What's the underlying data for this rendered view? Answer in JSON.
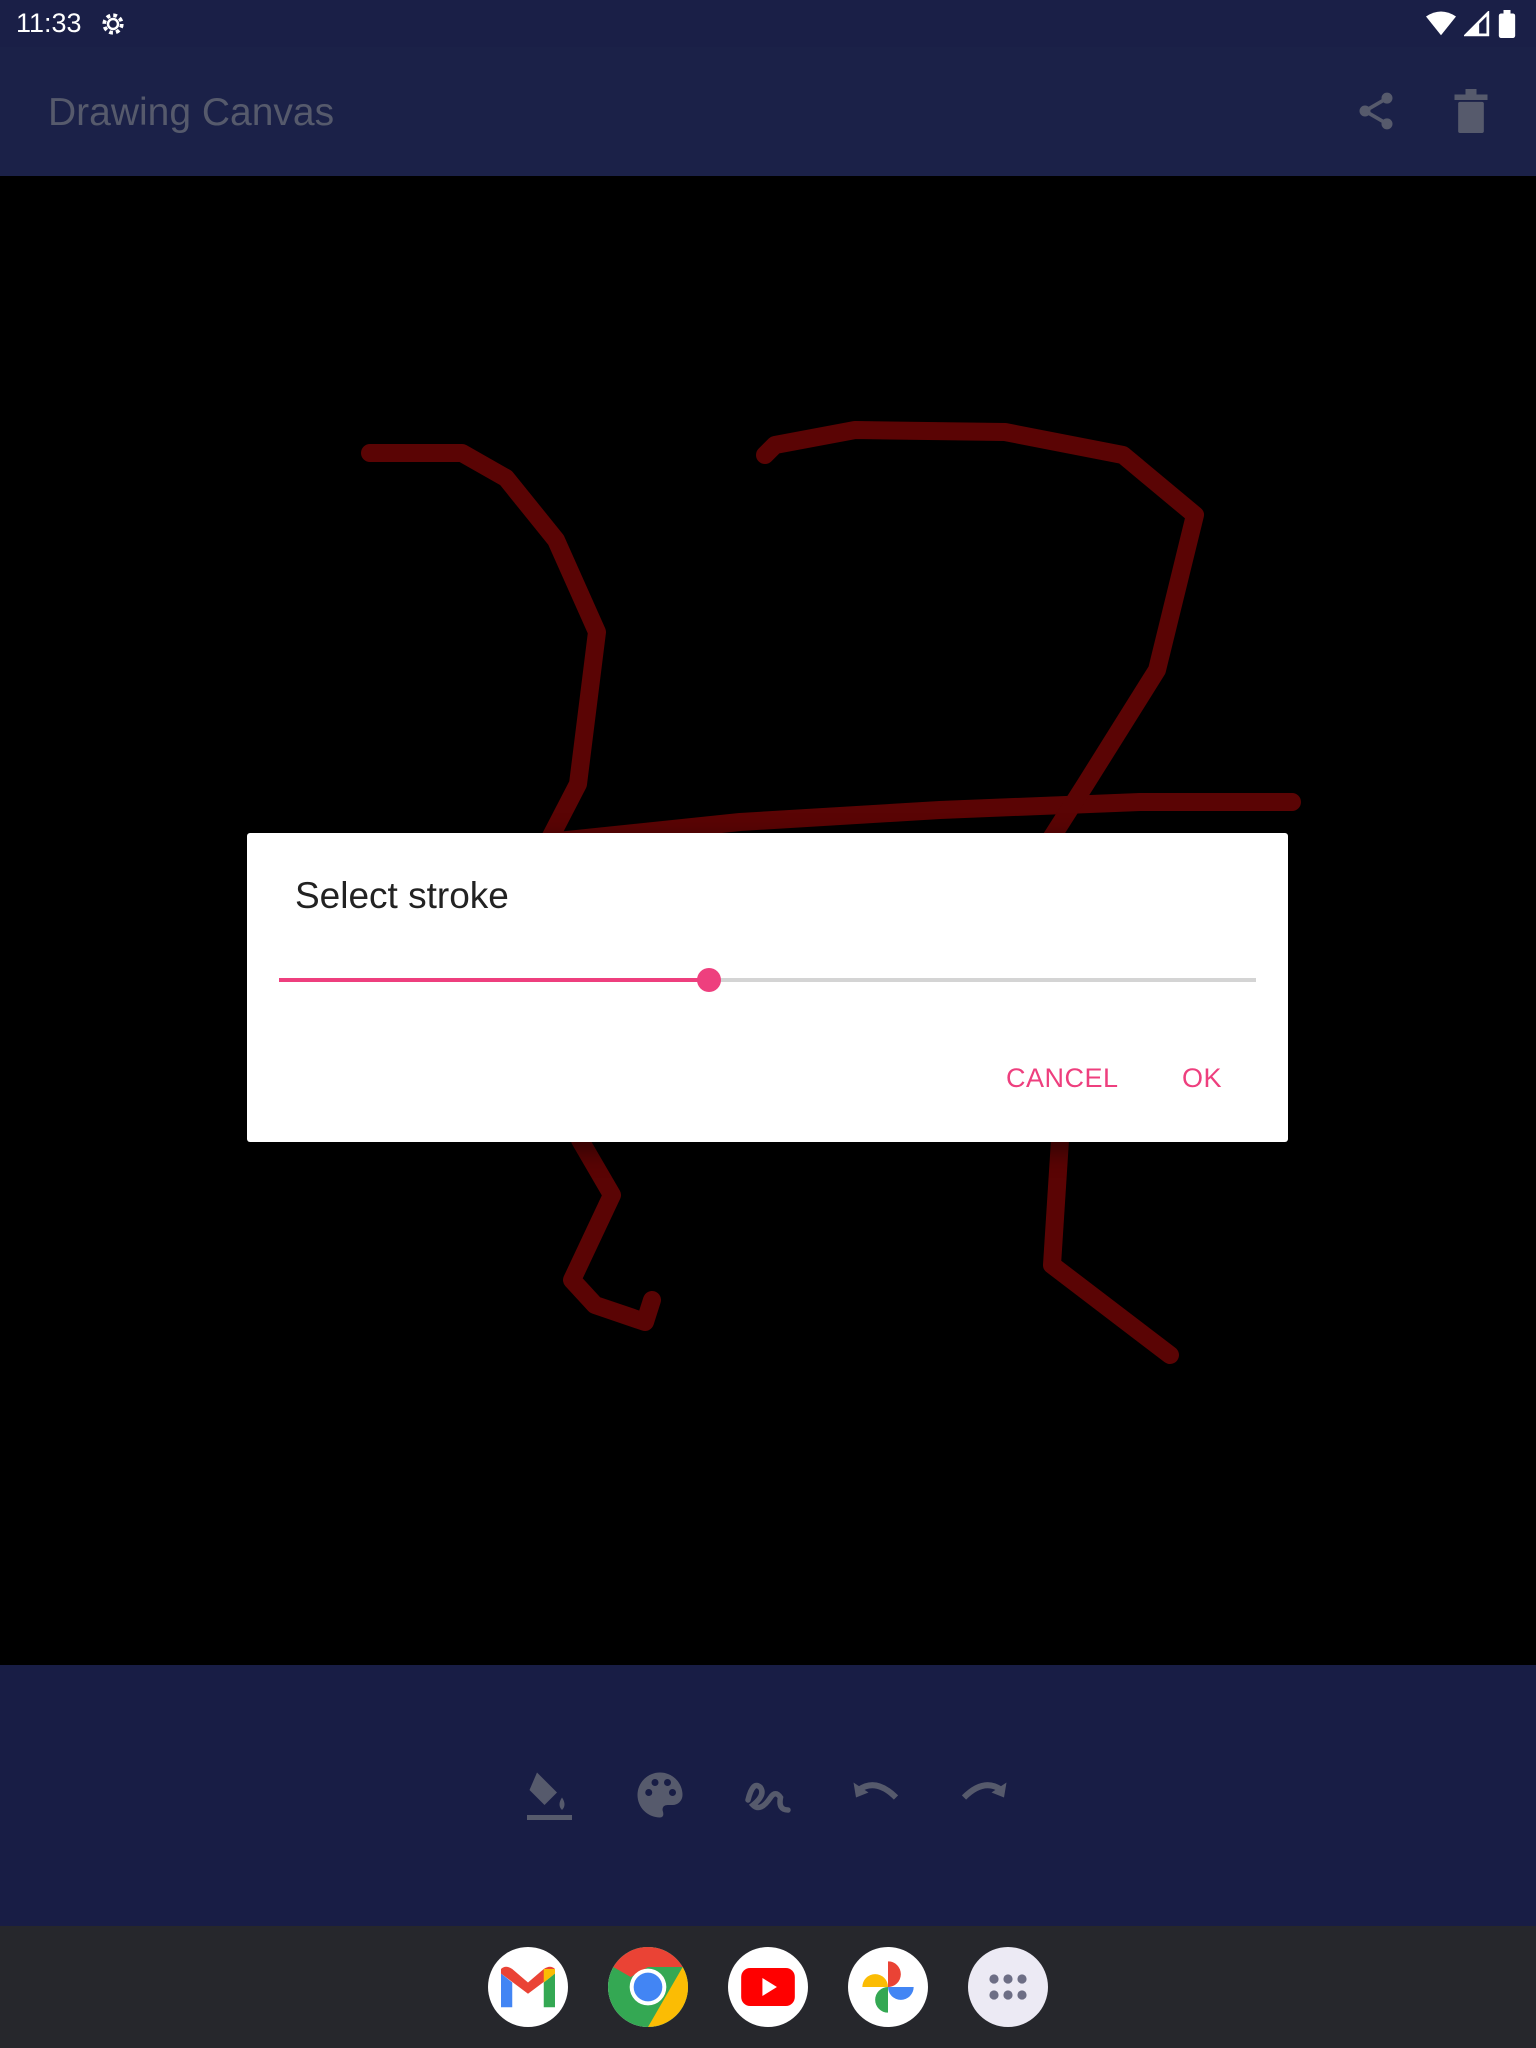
{
  "status_bar": {
    "time": "11:33",
    "icons": [
      "settings-icon",
      "wifi-icon",
      "signal-icon",
      "battery-icon"
    ]
  },
  "app_bar": {
    "title": "Drawing Canvas",
    "actions": [
      "share-icon",
      "delete-icon"
    ]
  },
  "dialog": {
    "title": "Select stroke",
    "stroke_level": 0.44,
    "cancel_label": "CANCEL",
    "ok_label": "OK"
  },
  "toolbar": {
    "tools": [
      "fill-color-icon",
      "palette-icon",
      "stroke-icon",
      "undo-icon",
      "redo-icon"
    ]
  },
  "dock": {
    "apps": [
      "Gmail",
      "Chrome",
      "YouTube",
      "Photos",
      "App drawer"
    ]
  },
  "colors": {
    "accent": "#ee3f7e",
    "app_bar": "#1b2148",
    "stroke": "#5a0404",
    "canvas": "#000000"
  }
}
